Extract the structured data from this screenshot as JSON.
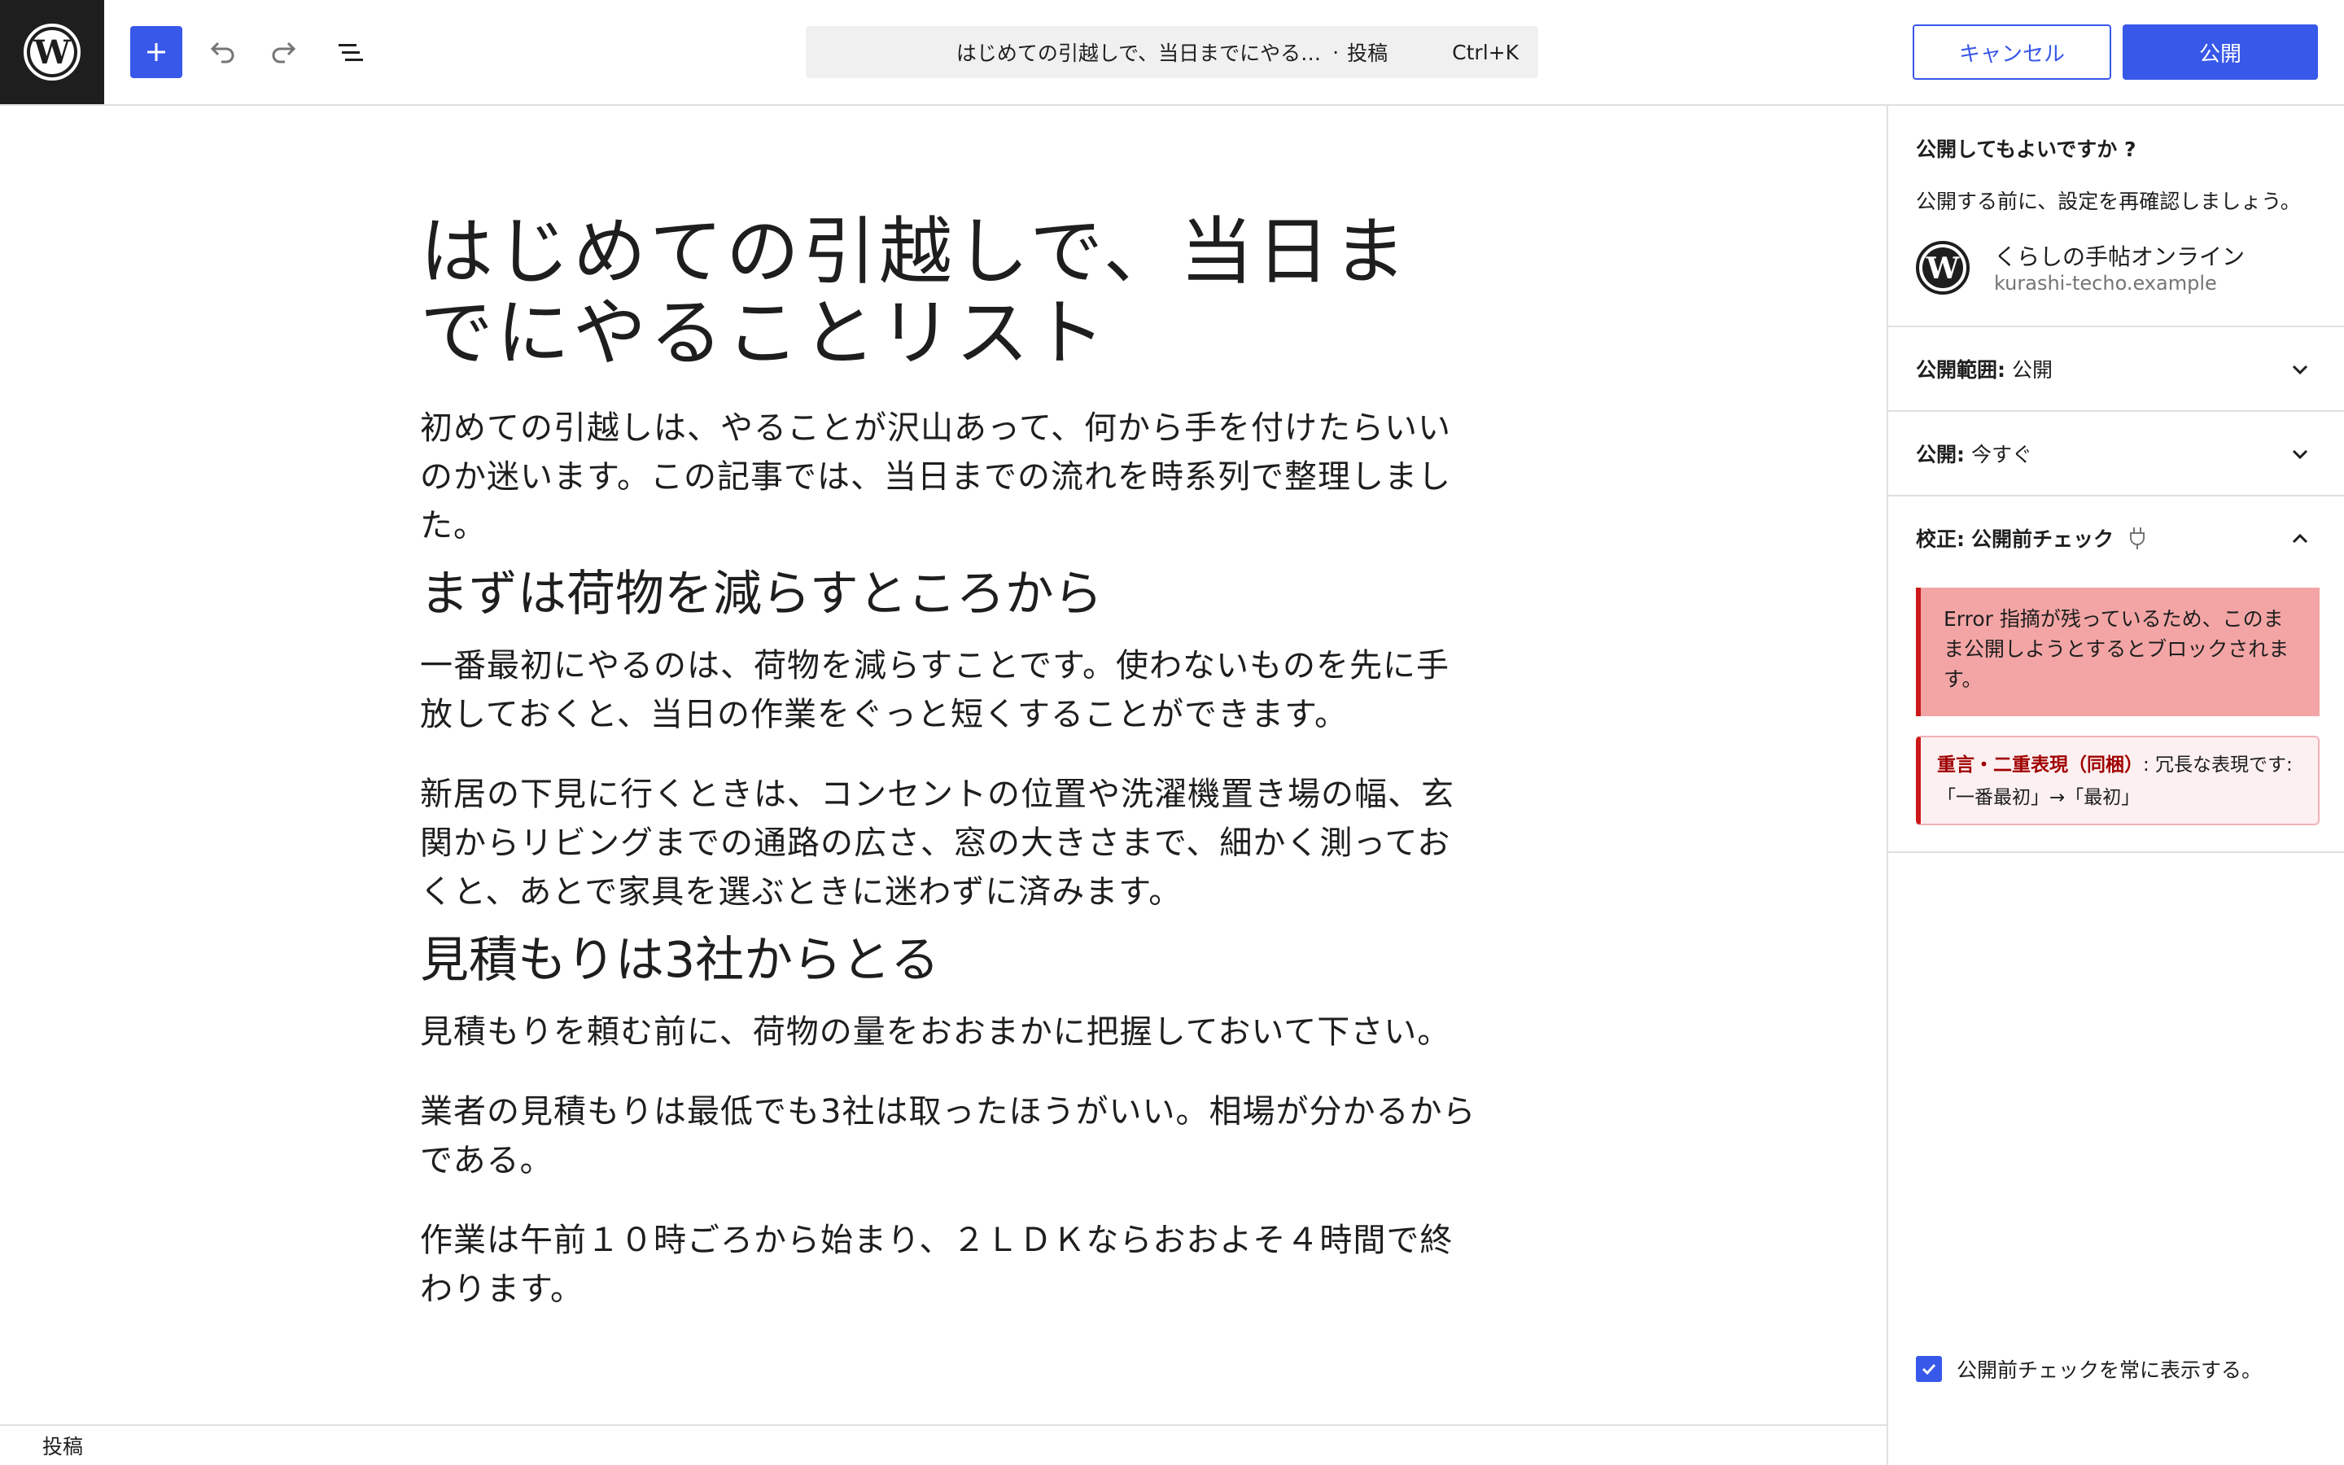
{
  "toolbar": {
    "logo": "wordpress-logo",
    "inserter_icon": "plus-icon",
    "undo_icon": "undo-icon",
    "redo_icon": "redo-icon",
    "list_view_icon": "list-view-icon",
    "command": {
      "title": "はじめての引越しで、当日までにやる…",
      "separator": "·",
      "post_type": "投稿",
      "shortcut": "Ctrl+K"
    },
    "cancel_label": "キャンセル",
    "publish_label": "公開"
  },
  "post": {
    "title": "はじめての引越しで、当日までにやることリスト",
    "blocks": [
      {
        "type": "paragraph",
        "text": "初めての引越しは、やることが沢山あって、何から手を付けたらいいのか迷います。この記事では、当日までの流れを時系列で整理しました。"
      },
      {
        "type": "heading",
        "text": "まずは荷物を減らすところから"
      },
      {
        "type": "paragraph",
        "text": "一番最初にやるのは、荷物を減らすことです。使わないものを先に手放しておくと、当日の作業をぐっと短くすることができます。"
      },
      {
        "type": "paragraph",
        "text": "新居の下見に行くときは、コンセントの位置や洗濯機置き場の幅、玄関からリビングまでの通路の広さ、窓の大きさまで、細かく測っておくと、あとで家具を選ぶときに迷わずに済みます。"
      },
      {
        "type": "heading",
        "text": "見積もりは3社からとる"
      },
      {
        "type": "paragraph",
        "text": "見積もりを頼む前に、荷物の量をおおまかに把握しておいて下さい。"
      },
      {
        "type": "paragraph",
        "text": "業者の見積もりは最低でも3社は取ったほうがいい。相場が分かるからである。"
      },
      {
        "type": "paragraph",
        "text": "作業は午前１０時ごろから始まり、２ＬＤＫならおおよそ４時間で終わります。"
      }
    ]
  },
  "footer": {
    "breadcrumb": "投稿"
  },
  "sidebar": {
    "title": "公開してもよいですか ?",
    "intro": "公開する前に、設定を再確認しましょう。",
    "site": {
      "icon": "wordpress-site-icon",
      "name": "くらしの手帖オンライン",
      "url": "kurashi-techo.example"
    },
    "visibility": {
      "label": "公開範囲:",
      "value": "公開"
    },
    "publish": {
      "label": "公開:",
      "value": "今すぐ"
    },
    "proofread": {
      "label": "校正:",
      "value": "公開前チェック",
      "icon": "plug-icon"
    },
    "error_notice": "Error 指摘が残っているため、このまま公開しようとするとブロックされます。",
    "issue": {
      "type": "重言・二重表現（同梱）",
      "message": ": 冗長な表現です:「一番最初」→「最初」"
    },
    "always_show": {
      "label": "公開前チェックを常に表示する。",
      "checked": true
    }
  },
  "colors": {
    "accent": "#3858e9",
    "error": "#cc1818",
    "error_bg": "#f3a5a5",
    "issue_bg": "#fcf0f1"
  }
}
